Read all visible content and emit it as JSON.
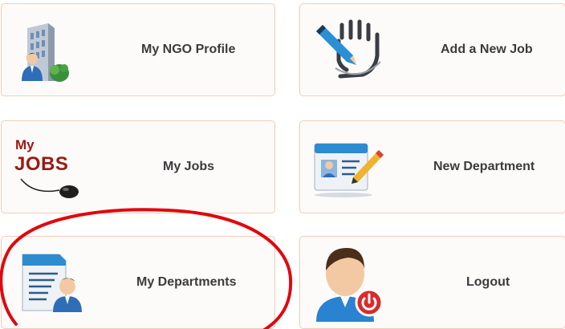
{
  "tiles": {
    "ngo_profile": {
      "label": "My NGO Profile",
      "icon": "building-user-icon"
    },
    "add_job": {
      "label": "Add a New Job",
      "icon": "hand-writing-icon"
    },
    "my_jobs": {
      "label": "My Jobs",
      "icon": "jobs-mouse-icon",
      "logo_my": "My",
      "logo_jobs": "JOBS"
    },
    "new_department": {
      "label": "New Department",
      "icon": "id-card-pencil-icon"
    },
    "my_departments": {
      "label": "My Departments",
      "icon": "document-user-icon"
    },
    "logout": {
      "label": "Logout",
      "icon": "user-power-icon"
    }
  },
  "annotation": {
    "shape": "red-ellipse",
    "target": "my_departments",
    "color": "#e0080f"
  }
}
